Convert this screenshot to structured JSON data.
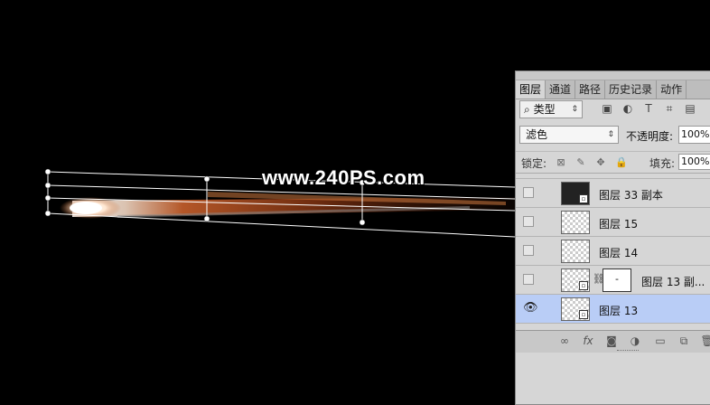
{
  "watermark": "www.240PS.com",
  "panel": {
    "tabs": [
      "图层",
      "通道",
      "路径",
      "历史记录",
      "动作"
    ],
    "active_tab": 0,
    "filter": {
      "kind_label": "类型",
      "icons": [
        "image-filter-icon",
        "adjustment-filter-icon",
        "type-filter-icon",
        "shape-filter-icon",
        "smart-object-filter-icon"
      ]
    },
    "blend_mode": "滤色",
    "opacity_label": "不透明度:",
    "opacity_value": "100%",
    "lock_label": "锁定:",
    "fill_label": "填充:",
    "fill_value": "100%",
    "layers": [
      {
        "name": "图层 33 副本",
        "visible": false,
        "selected": false,
        "has_mask": false
      },
      {
        "name": "图层 15",
        "visible": false,
        "selected": false,
        "has_mask": false
      },
      {
        "name": "图层 14",
        "visible": false,
        "selected": false,
        "has_mask": false
      },
      {
        "name": "图层 13 副...",
        "visible": false,
        "selected": false,
        "has_mask": true,
        "mask_symbol": "-"
      },
      {
        "name": "图层 13",
        "visible": true,
        "selected": true,
        "has_mask": false
      }
    ],
    "bottom_icons": [
      "link-icon",
      "fx-icon",
      "mask-icon",
      "adjustment-icon",
      "folder-icon",
      "new-layer-icon",
      "trash-icon"
    ]
  },
  "colors": {
    "selected_row": "#b9cdf6",
    "panel_bg": "#d6d6d6",
    "canvas_bg": "#000000"
  }
}
